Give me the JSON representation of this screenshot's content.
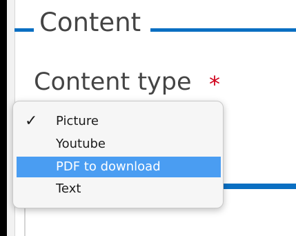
{
  "fieldset": {
    "legend": "Content"
  },
  "field": {
    "label": "Content type",
    "required_marker": "*"
  },
  "dropdown": {
    "checkmark": "✓",
    "options": [
      {
        "label": "Picture",
        "checked": true,
        "highlighted": false
      },
      {
        "label": "Youtube",
        "checked": false,
        "highlighted": false
      },
      {
        "label": "PDF to download",
        "checked": false,
        "highlighted": true
      },
      {
        "label": "Text",
        "checked": false,
        "highlighted": false
      }
    ]
  },
  "colors": {
    "accent_blue": "#0a6fc2",
    "highlight_blue": "#4a9df2",
    "required_red": "#d0021b"
  }
}
